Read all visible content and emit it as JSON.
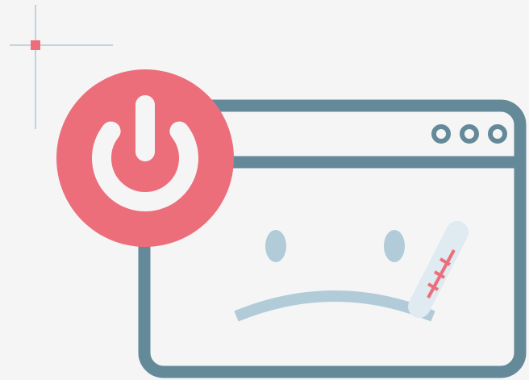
{
  "illustration": {
    "colors": {
      "background": "#f5f5f6",
      "window_outline": "#648a99",
      "accent_red": "#ed6e7b",
      "face_blue": "#b1cbd8",
      "thermometer_fill": "#dfeaf1",
      "crosshair_line": "#c5d2dc",
      "power_symbol": "#f5f5f6"
    },
    "icons": [
      "crosshair-icon",
      "power-icon",
      "browser-window-icon",
      "window-control-dot-icon",
      "sad-face-icon",
      "thermometer-icon"
    ]
  }
}
